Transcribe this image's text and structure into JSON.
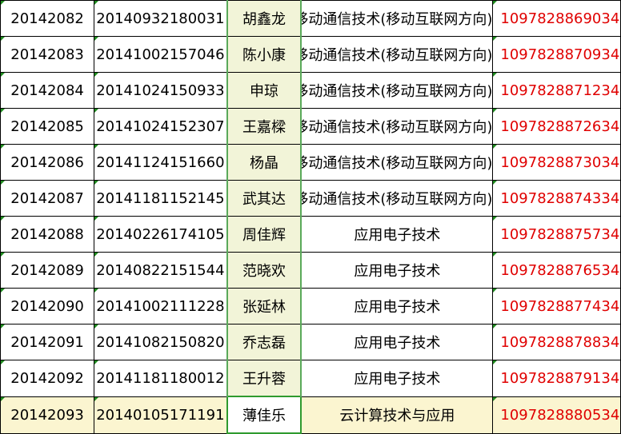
{
  "rows": [
    {
      "id": "20142082",
      "no": "20140932180031",
      "name": "胡鑫龙",
      "major": "移动通信技术(移动互联网方向)",
      "phone": "1097828869034"
    },
    {
      "id": "20142083",
      "no": "20141002157046",
      "name": "陈小康",
      "major": "移动通信技术(移动互联网方向)",
      "phone": "1097828870934"
    },
    {
      "id": "20142084",
      "no": "20141024150933",
      "name": "申琼",
      "major": "移动通信技术(移动互联网方向)",
      "phone": "1097828871234"
    },
    {
      "id": "20142085",
      "no": "20141024152307",
      "name": "王嘉樑",
      "major": "移动通信技术(移动互联网方向)",
      "phone": "1097828872634"
    },
    {
      "id": "20142086",
      "no": "20141124151660",
      "name": "杨晶",
      "major": "移动通信技术(移动互联网方向)",
      "phone": "1097828873034"
    },
    {
      "id": "20142087",
      "no": "20141181152145",
      "name": "武其达",
      "major": "移动通信技术(移动互联网方向)",
      "phone": "1097828874334"
    },
    {
      "id": "20142088",
      "no": "20140226174105",
      "name": "周佳辉",
      "major": "应用电子技术",
      "phone": "1097828875734"
    },
    {
      "id": "20142089",
      "no": "20140822151544",
      "name": "范晓欢",
      "major": "应用电子技术",
      "phone": "1097828876534"
    },
    {
      "id": "20142090",
      "no": "20141002111228",
      "name": "张延林",
      "major": "应用电子技术",
      "phone": "1097828877434"
    },
    {
      "id": "20142091",
      "no": "20141082150820",
      "name": "乔志磊",
      "major": "应用电子技术",
      "phone": "1097828878834"
    },
    {
      "id": "20142092",
      "no": "20141181180012",
      "name": "王升蓉",
      "major": "应用电子技术",
      "phone": "1097828879134"
    },
    {
      "id": "20142093",
      "no": "20140105171191",
      "name": "薄佳乐",
      "major": "云计算技术与应用",
      "phone": "1097828880534"
    }
  ],
  "colors": {
    "grid": "#000000",
    "phone_text": "#e00000",
    "name_column_bg": "#f2f4d8",
    "selected_row_bg": "#fbf5d0",
    "selection_border": "#2e9a2e",
    "error_marker": "#1e8b1e"
  }
}
